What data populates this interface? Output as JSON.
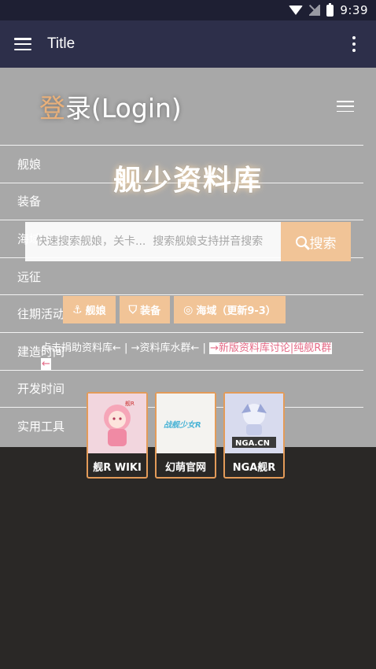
{
  "status_bar": {
    "time": "9:39"
  },
  "app_bar": {
    "title": "Title"
  },
  "login_header": {
    "first_char": "登",
    "rest": "录(Login)"
  },
  "nav": {
    "items": [
      "舰娘",
      "装备",
      "海域",
      "远征",
      "往期活动",
      "建造时间",
      "开发时间",
      "实用工具"
    ]
  },
  "site": {
    "title": "舰少资料库"
  },
  "search": {
    "placeholder": "快速搜索舰娘，关卡...  搜索舰娘支持拼音搜索",
    "button_label": "搜索"
  },
  "categories": [
    {
      "icon": "anchor-icon",
      "label": "舰娘"
    },
    {
      "icon": "shield-icon",
      "label": "装备"
    },
    {
      "icon": "globe-icon",
      "label": "海域（更新9-3）"
    }
  ],
  "links": {
    "donate": "点击捐助资料库←",
    "sep1": " | ",
    "qq_group": "→资料库水群←",
    "sep2": " | ",
    "new_forum": "→新版资料库讨论|纯舰R群",
    "arrow_end": "←"
  },
  "cards": [
    {
      "label": "舰R WIKI",
      "image_text": "舰R"
    },
    {
      "label": "幻萌官网",
      "image_text": "战舰少女R"
    },
    {
      "label": "NGA舰R",
      "image_text": "NGA.CN"
    }
  ],
  "colors": {
    "accent": "#f1c497",
    "card_border": "#e39b59",
    "highlight_text": "#e46a86",
    "app_bar": "#2d2f4a",
    "status_bar": "#1e1f33"
  }
}
